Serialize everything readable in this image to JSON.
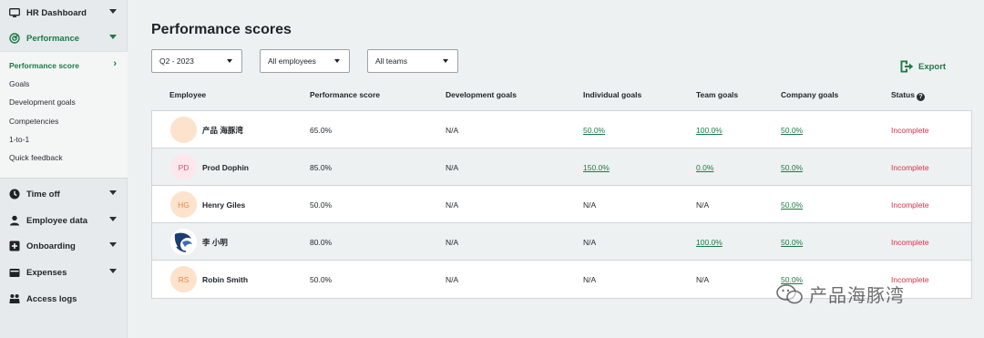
{
  "sidebar": {
    "items": [
      {
        "label": "HR Dashboard",
        "icon": "monitor-icon"
      },
      {
        "label": "Performance",
        "icon": "target-icon",
        "active": true
      },
      {
        "label": "Time off",
        "icon": "clock-icon"
      },
      {
        "label": "Employee data",
        "icon": "person-icon"
      },
      {
        "label": "Onboarding",
        "icon": "plus-square-icon"
      },
      {
        "label": "Expenses",
        "icon": "wallet-icon"
      },
      {
        "label": "Access logs",
        "icon": "people-icon"
      }
    ],
    "performance_sub": [
      "Performance score",
      "Goals",
      "Development goals",
      "Competencies",
      "1-to-1",
      "Quick feedback"
    ]
  },
  "page": {
    "title": "Performance scores",
    "filters": {
      "quarter": "Q2 - 2023",
      "employees": "All employees",
      "teams": "All teams"
    },
    "export_label": "Export"
  },
  "table": {
    "headers": [
      "Employee",
      "Performance score",
      "Development goals",
      "Individual goals",
      "Team goals",
      "Company goals",
      "Status"
    ],
    "rows": [
      {
        "initials": "",
        "name": "产品 海豚湾",
        "score": "65.0%",
        "dev": "N/A",
        "individual": "50.0%",
        "team": "100.0%",
        "company": "50.0%",
        "status": "Incomplete"
      },
      {
        "initials": "PD",
        "name": "Prod Dophin",
        "score": "85.0%",
        "dev": "N/A",
        "individual": "150.0%",
        "team": "0.0%",
        "company": "50.0%",
        "status": "Incomplete"
      },
      {
        "initials": "HG",
        "name": "Henry Giles",
        "score": "50.0%",
        "dev": "N/A",
        "individual": "N/A",
        "team": "N/A",
        "company": "50.0%",
        "status": "Incomplete"
      },
      {
        "initials": "",
        "name": "李 小明",
        "score": "80.0%",
        "dev": "N/A",
        "individual": "N/A",
        "team": "100.0%",
        "company": "50.0%",
        "status": "Incomplete"
      },
      {
        "initials": "RS",
        "name": "Robin Smith",
        "score": "50.0%",
        "dev": "N/A",
        "individual": "N/A",
        "team": "N/A",
        "company": "50.0%",
        "status": "Incomplete"
      }
    ]
  },
  "watermark": "产品海豚湾",
  "colors": {
    "accent": "#1b7a46",
    "status_incomplete": "#d9304a",
    "avatar_peach": "#fde2cc",
    "avatar_pink": "#fce8ec"
  }
}
